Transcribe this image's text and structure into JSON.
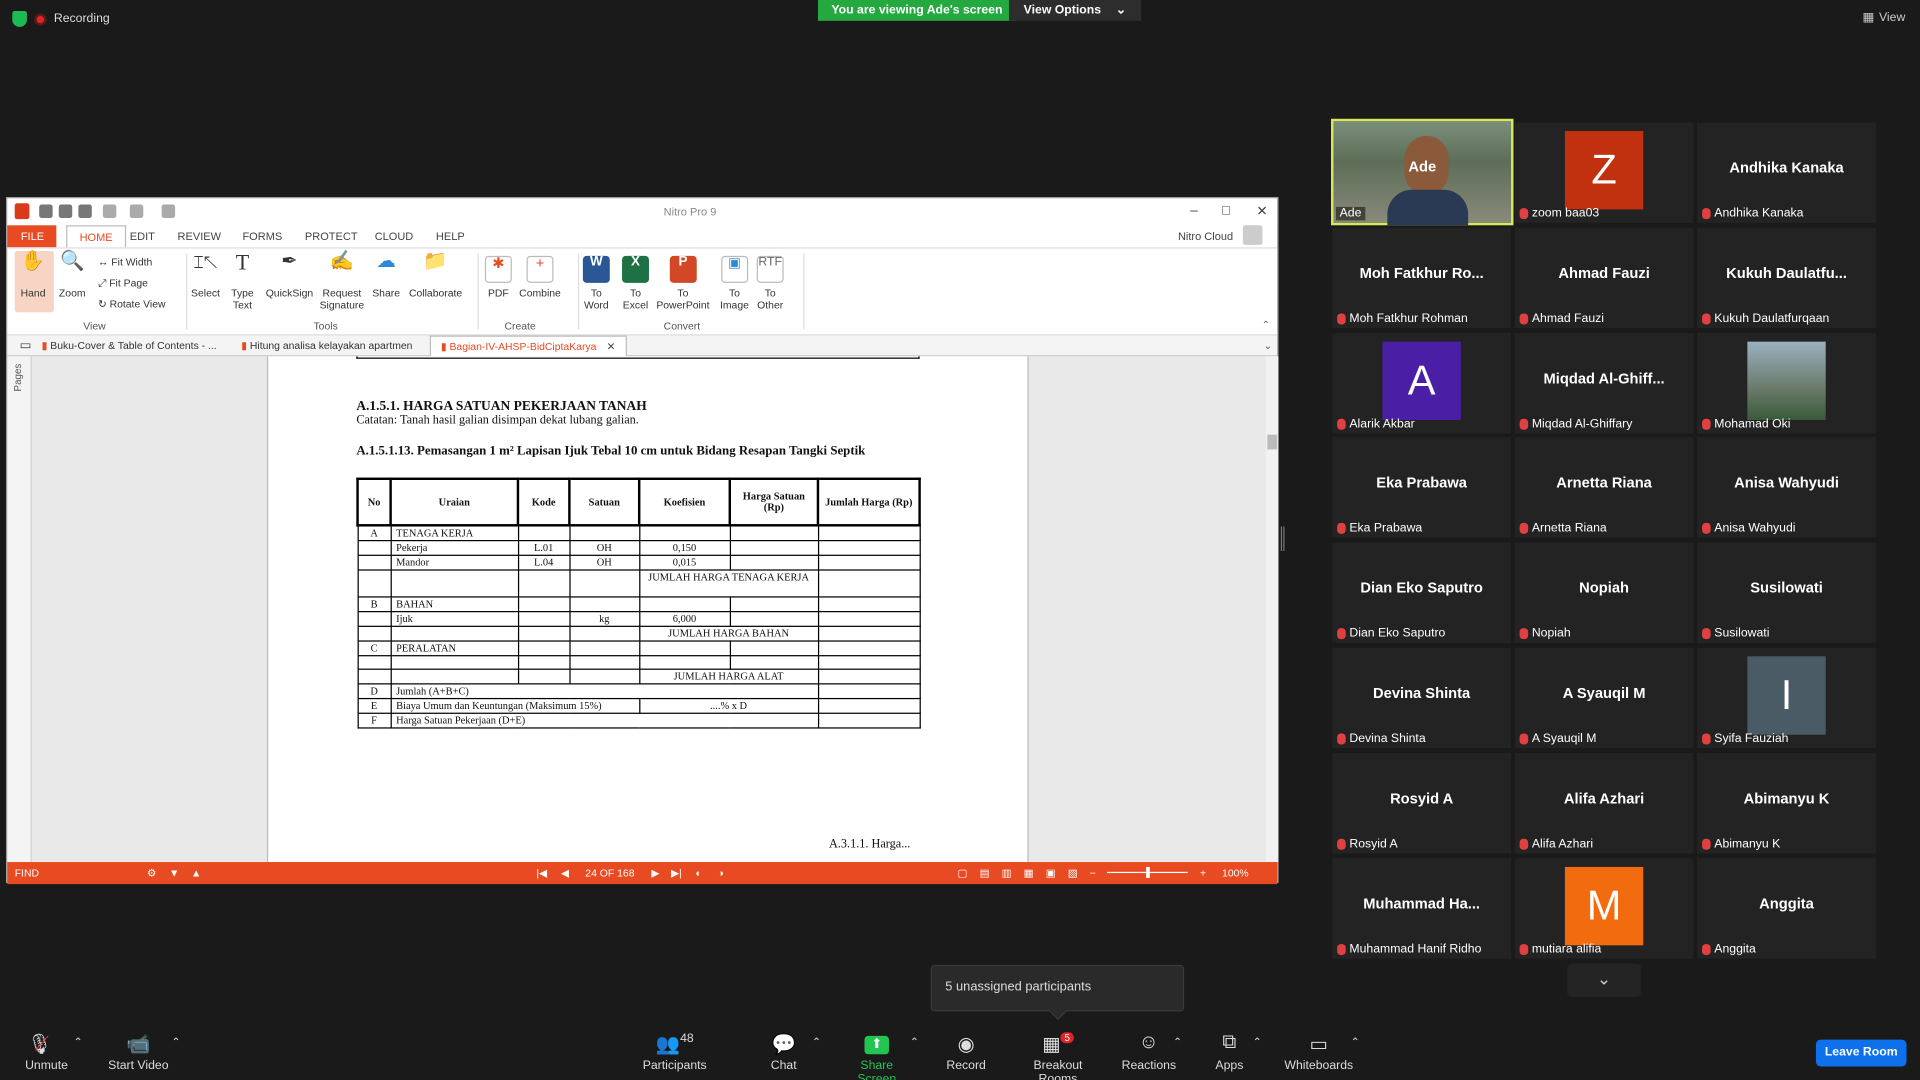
{
  "topbar": {
    "recording": "Recording",
    "viewing": "You are viewing Ade's screen",
    "view_options": "View Options",
    "view": "View"
  },
  "nitro": {
    "title": "Nitro Pro 9",
    "menu": [
      "FILE",
      "HOME",
      "EDIT",
      "REVIEW",
      "FORMS",
      "PROTECT",
      "CLOUD",
      "HELP"
    ],
    "nitro_cloud": "Nitro Cloud",
    "ribbon": {
      "hand": "Hand",
      "zoom": "Zoom",
      "fit_width": "Fit Width",
      "fit_page": "Fit Page",
      "rotate_view": "Rotate View",
      "view_group": "View",
      "select": "Select",
      "type_text": "Type\nText",
      "quicksign": "QuickSign",
      "request_signature": "Request\nSignature",
      "share": "Share",
      "collaborate": "Collaborate",
      "tools_group": "Tools",
      "pdf": "PDF",
      "combine": "Combine",
      "create_group": "Create",
      "to_word": "To\nWord",
      "to_excel": "To\nExcel",
      "to_powerpoint": "To\nPowerPoint",
      "to_image": "To\nImage",
      "to_other": "To\nOther",
      "convert_group": "Convert"
    },
    "tabs": [
      "Buku-Cover & Table of Contents - ...",
      "Hitung analisa kelayakan apartmen",
      "Bagian-IV-AHSP-BidCiptaKarya"
    ],
    "pages_panel": "Pages",
    "status": {
      "find": "FIND",
      "page": "24 OF 168",
      "zoom": "100%"
    }
  },
  "document": {
    "heading": "A.1.5.1.  HARGA SATUAN PEKERJAAN TANAH",
    "note": "Catatan: Tanah hasil galian disimpan dekat lubang galian.",
    "subheading": "A.1.5.1.13. Pemasangan 1 m² Lapisan Ijuk Tebal 10 cm untuk Bidang Resapan Tangki Septik",
    "headers": [
      "No",
      "Uraian",
      "Kode",
      "Satuan",
      "Koefisien",
      "Harga Satuan (Rp)",
      "Jumlah Harga (Rp)"
    ],
    "rows": {
      "a": [
        "A",
        "TENAGA KERJA"
      ],
      "pekerja": [
        "Pekerja",
        "L.01",
        "OH",
        "0,150"
      ],
      "mandor": [
        "Mandor",
        "L.04",
        "OH",
        "0,015"
      ],
      "jml_tk": "JUMLAH HARGA TENAGA KERJA",
      "b": [
        "B",
        "BAHAN"
      ],
      "ijuk": [
        "Ijuk",
        "kg",
        "6,000"
      ],
      "jml_bahan": "JUMLAH HARGA BAHAN",
      "c": [
        "C",
        "PERALATAN"
      ],
      "jml_alat": "JUMLAH HARGA ALAT",
      "d": [
        "D",
        "Jumlah (A+B+C)"
      ],
      "e": [
        "E",
        "Biaya Umum dan Keuntungan (Maksimum 15%)",
        "....% x D"
      ],
      "f": [
        "F",
        "Harga Satuan Pekerjaan (D+E)"
      ]
    },
    "footer": "A.3.1.1. Harga..."
  },
  "participants": [
    {
      "name": "Ade",
      "label": "Ade"
    },
    {
      "name": "",
      "label": "zoom baa03",
      "avatar": "Z",
      "color": "#c1310f"
    },
    {
      "name": "Andhika Kanaka",
      "label": "Andhika Kanaka"
    },
    {
      "name": "Moh Fatkhur Ro...",
      "label": "Moh Fatkhur Rohman"
    },
    {
      "name": "Ahmad Fauzi",
      "label": "Ahmad Fauzi"
    },
    {
      "name": "Kukuh  Daulatfu...",
      "label": "Kukuh Daulatfurqaan"
    },
    {
      "name": "",
      "label": "Alarik Akbar",
      "avatar": "A",
      "color": "#4a1fa6"
    },
    {
      "name": "Miqdad  Al-Ghiff...",
      "label": "Miqdad Al-Ghiffary"
    },
    {
      "name": "",
      "label": "Mohamad Oki",
      "avatar": "photo",
      "color": "#6b7b86"
    },
    {
      "name": "Eka Prabawa",
      "label": "Eka Prabawa"
    },
    {
      "name": "Arnetta Riana",
      "label": "Arnetta Riana"
    },
    {
      "name": "Anisa Wahyudi",
      "label": "Anisa Wahyudi"
    },
    {
      "name": "Dian Eko Saputro",
      "label": "Dian Eko Saputro"
    },
    {
      "name": "Nopiah",
      "label": "Nopiah"
    },
    {
      "name": "Susilowati",
      "label": "Susilowati"
    },
    {
      "name": "Devina Shinta",
      "label": "Devina Shinta"
    },
    {
      "name": "A Syauqil M",
      "label": "A Syauqil M"
    },
    {
      "name": "",
      "label": "Syifa Fauziah",
      "avatar": "I",
      "color": "#4b5b66"
    },
    {
      "name": "Rosyid A",
      "label": "Rosyid A"
    },
    {
      "name": "Alifa Azhari",
      "label": "Alifa Azhari"
    },
    {
      "name": "Abimanyu K",
      "label": "Abimanyu K"
    },
    {
      "name": "Muhammad  Ha...",
      "label": "Muhammad Hanif Ridho"
    },
    {
      "name": "",
      "label": "mutiara alifia",
      "avatar": "M",
      "color": "#f26b0f"
    },
    {
      "name": "Anggita",
      "label": "Anggita"
    }
  ],
  "popup": {
    "unassigned": "5 unassigned participants"
  },
  "toolbar": {
    "unmute": "Unmute",
    "start_video": "Start Video",
    "participants": "Participants",
    "participants_count": "48",
    "chat": "Chat",
    "share_screen": "Share Screen",
    "record": "Record",
    "breakout_rooms": "Breakout Rooms",
    "breakout_badge": "5",
    "reactions": "Reactions",
    "apps": "Apps",
    "whiteboards": "Whiteboards",
    "leave_room": "Leave Room"
  }
}
